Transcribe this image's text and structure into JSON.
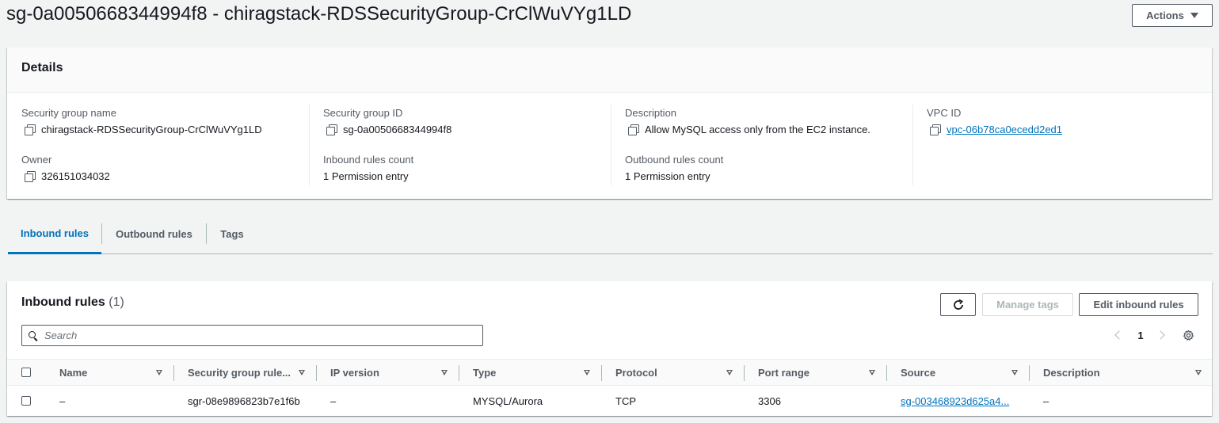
{
  "header": {
    "title": "sg-0a0050668344994f8 - chiragstack-RDSSecurityGroup-CrClWuVYg1LD",
    "actions_label": "Actions"
  },
  "details": {
    "heading": "Details",
    "security_group_name": {
      "label": "Security group name",
      "value": "chiragstack-RDSSecurityGroup-CrClWuVYg1LD"
    },
    "security_group_id": {
      "label": "Security group ID",
      "value": "sg-0a0050668344994f8"
    },
    "description": {
      "label": "Description",
      "value": "Allow MySQL access only from the EC2 instance."
    },
    "vpc_id": {
      "label": "VPC ID",
      "value": "vpc-06b78ca0ecedd2ed1"
    },
    "owner": {
      "label": "Owner",
      "value": "326151034032"
    },
    "inbound_rules_count": {
      "label": "Inbound rules count",
      "value": "1 Permission entry"
    },
    "outbound_rules_count": {
      "label": "Outbound rules count",
      "value": "1 Permission entry"
    }
  },
  "tabs": [
    {
      "label": "Inbound rules",
      "active": true
    },
    {
      "label": "Outbound rules",
      "active": false
    },
    {
      "label": "Tags",
      "active": false
    }
  ],
  "inbound": {
    "title": "Inbound rules",
    "count": "(1)",
    "manage_tags_label": "Manage tags",
    "edit_label": "Edit inbound rules",
    "search_placeholder": "Search",
    "page": "1",
    "columns": [
      "Name",
      "Security group rule...",
      "IP version",
      "Type",
      "Protocol",
      "Port range",
      "Source",
      "Description"
    ],
    "rows": [
      {
        "name": "–",
        "rule_id": "sgr-08e9896823b7e1f6b",
        "ip_version": "–",
        "type": "MYSQL/Aurora",
        "protocol": "TCP",
        "port_range": "3306",
        "source": "sg-003468923d625a4...",
        "description": "–"
      }
    ]
  },
  "colors": {
    "link": "#0073bb",
    "text": "#16191f",
    "muted": "#545b64",
    "background": "#f2f3f3"
  }
}
